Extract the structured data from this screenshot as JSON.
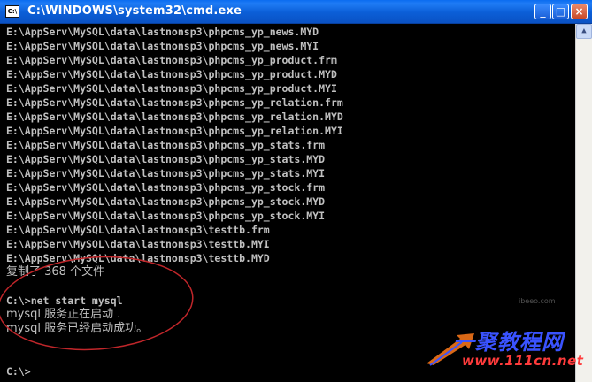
{
  "window": {
    "title": "C:\\WINDOWS\\system32\\cmd.exe",
    "icon_label": "C:\\",
    "controls": {
      "minimize": "_",
      "maximize": "□",
      "close": "×"
    }
  },
  "console": {
    "lines": [
      "E:\\AppServ\\MySQL\\data\\lastnonsp3\\phpcms_yp_news.MYD",
      "E:\\AppServ\\MySQL\\data\\lastnonsp3\\phpcms_yp_news.MYI",
      "E:\\AppServ\\MySQL\\data\\lastnonsp3\\phpcms_yp_product.frm",
      "E:\\AppServ\\MySQL\\data\\lastnonsp3\\phpcms_yp_product.MYD",
      "E:\\AppServ\\MySQL\\data\\lastnonsp3\\phpcms_yp_product.MYI",
      "E:\\AppServ\\MySQL\\data\\lastnonsp3\\phpcms_yp_relation.frm",
      "E:\\AppServ\\MySQL\\data\\lastnonsp3\\phpcms_yp_relation.MYD",
      "E:\\AppServ\\MySQL\\data\\lastnonsp3\\phpcms_yp_relation.MYI",
      "E:\\AppServ\\MySQL\\data\\lastnonsp3\\phpcms_yp_stats.frm",
      "E:\\AppServ\\MySQL\\data\\lastnonsp3\\phpcms_yp_stats.MYD",
      "E:\\AppServ\\MySQL\\data\\lastnonsp3\\phpcms_yp_stats.MYI",
      "E:\\AppServ\\MySQL\\data\\lastnonsp3\\phpcms_yp_stock.frm",
      "E:\\AppServ\\MySQL\\data\\lastnonsp3\\phpcms_yp_stock.MYD",
      "E:\\AppServ\\MySQL\\data\\lastnonsp3\\phpcms_yp_stock.MYI",
      "E:\\AppServ\\MySQL\\data\\lastnonsp3\\testtb.frm",
      "E:\\AppServ\\MySQL\\data\\lastnonsp3\\testtb.MYI",
      "E:\\AppServ\\MySQL\\data\\lastnonsp3\\testtb.MYD"
    ],
    "copy_summary": "复制了 368 个文件",
    "command": "C:\\>net start mysql",
    "status_starting": "mysql 服务正在启动 .",
    "status_started": "mysql 服务已经启动成功。",
    "prompt": "C:\\>"
  },
  "watermark": {
    "title": "一聚教程网",
    "url": "www.111cn.net"
  },
  "corner_tag": "ibeeo.com",
  "colors": {
    "console_text": "#c0c0c0",
    "console_bg": "#000000",
    "annotation": "#c0262a",
    "titlebar": "#0b5ed7"
  }
}
